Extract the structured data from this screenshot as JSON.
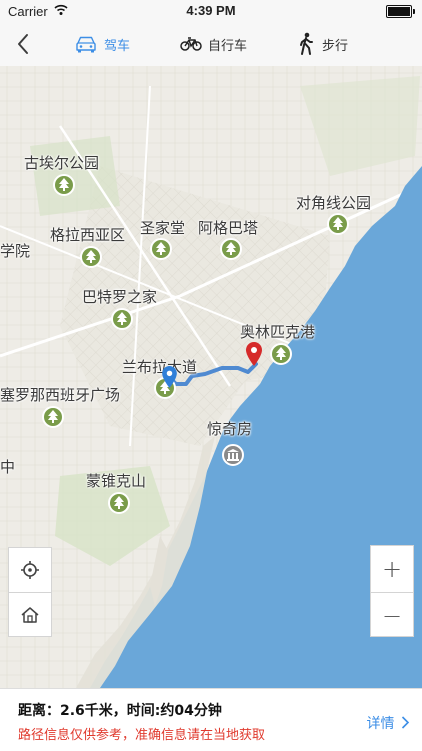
{
  "status_bar": {
    "carrier": "Carrier",
    "time": "4:39 PM"
  },
  "nav": {
    "tabs": [
      {
        "label": "驾车",
        "icon": "car-icon",
        "active": true
      },
      {
        "label": "自行车",
        "icon": "bicycle-icon",
        "active": false
      },
      {
        "label": "步行",
        "icon": "walking-icon",
        "active": false
      }
    ]
  },
  "map": {
    "labels": {
      "guell_park": "古埃尔公园",
      "gracia": "格拉西亚区",
      "sagrada": "圣家堂",
      "agbar": "阿格巴塔",
      "diagonal_park": "对角线公园",
      "college": "学院",
      "casa_batllo": "巴特罗之家",
      "olympic_port": "奥林匹克港",
      "rambla": "兰布拉大道",
      "plaza_espana": "塞罗那西班牙广场",
      "aquarium": "惊奇房",
      "montjuic": "蒙锥克山",
      "middle": "中"
    },
    "colors": {
      "sea": "#6aa7d9",
      "land": "#eceae3",
      "route": "#4f8ad1",
      "park": "#7a9c4a",
      "pin_red": "#d62a2a",
      "pin_blue": "#2f7fd8"
    }
  },
  "controls": {
    "zoom_in": "+",
    "zoom_out": "−"
  },
  "route": {
    "distance_text": "距离：2.6千米，时间:约04分钟",
    "notice": "路径信息仅供参考，准确信息请在当地获取",
    "detail_label": "详情"
  }
}
